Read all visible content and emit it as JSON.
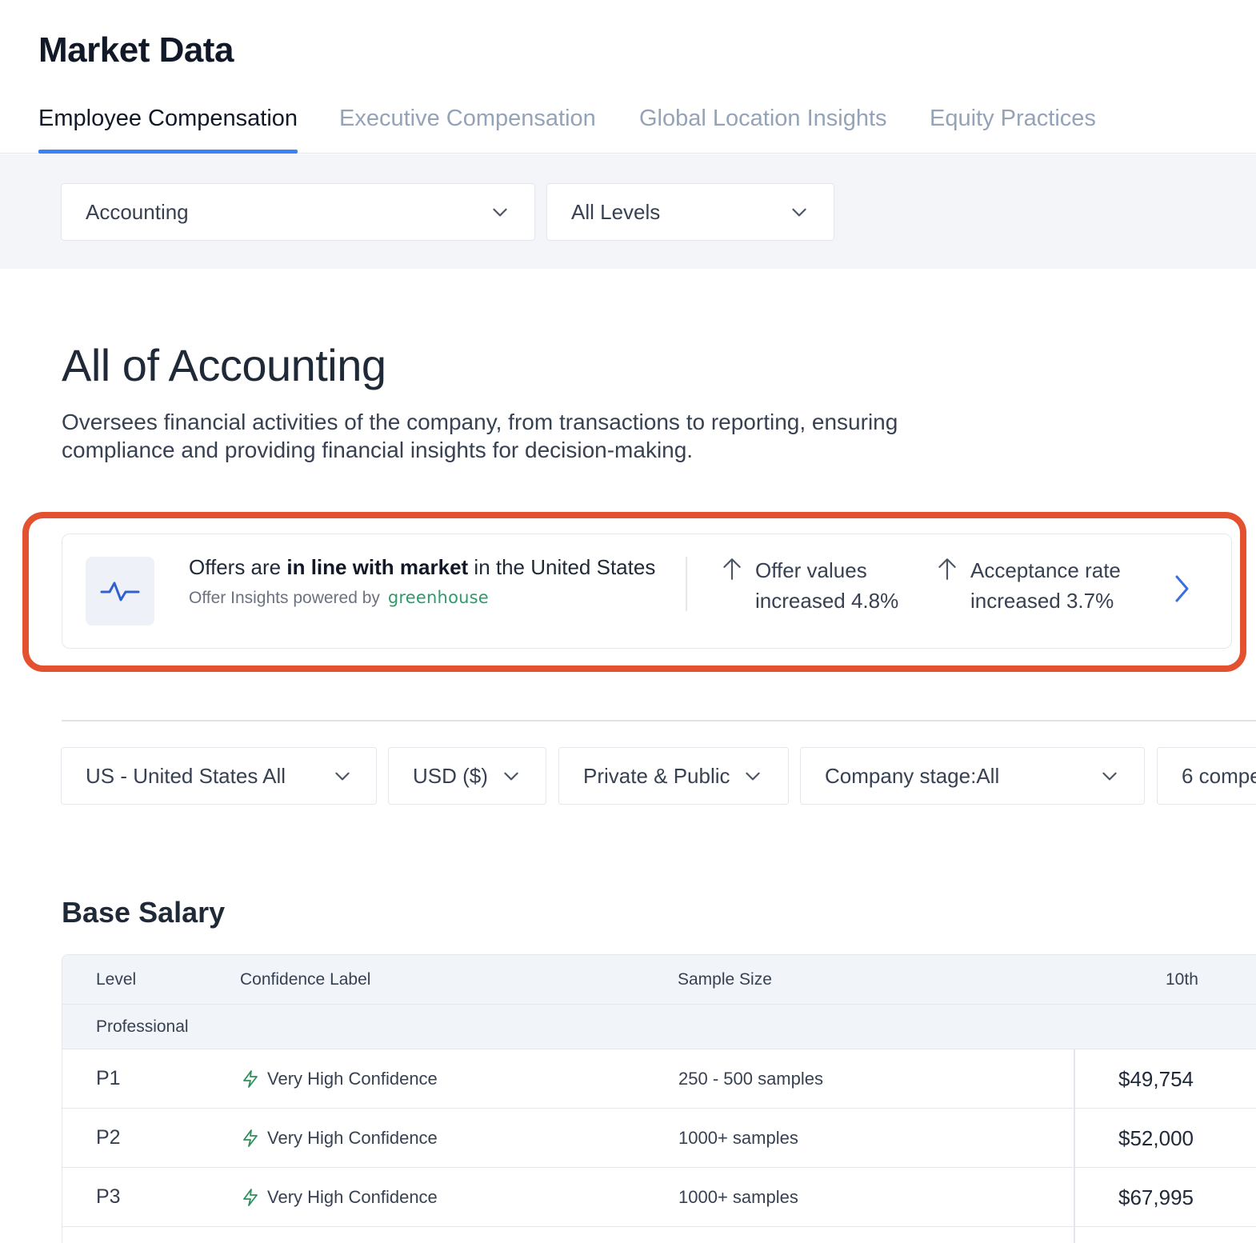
{
  "page": {
    "title": "Market Data"
  },
  "tabs": [
    {
      "label": "Employee Compensation",
      "active": true
    },
    {
      "label": "Executive Compensation",
      "active": false
    },
    {
      "label": "Global Location Insights",
      "active": false
    },
    {
      "label": "Equity Practices",
      "active": false
    }
  ],
  "filters": {
    "job_family": "Accounting",
    "level": "All Levels"
  },
  "section": {
    "title": "All of Accounting",
    "description": "Oversees financial activities of the company, from transactions to reporting, ensuring compliance and providing financial insights for decision-making."
  },
  "insight": {
    "prefix": "Offers are ",
    "emphasis": "in line with market",
    "suffix": " in the United States",
    "powered_by": "Offer Insights powered by",
    "partner_logo": "greenhouse",
    "stat1": {
      "line1": "Offer values",
      "line2": "increased 4.8%"
    },
    "stat2": {
      "line1": "Acceptance rate",
      "line2": "increased 3.7%"
    },
    "icon": "pulse-icon",
    "highlight_color": "#e4512f",
    "accent_color": "#3b82f6"
  },
  "secondary_filters": {
    "location": "US - United States All",
    "currency": "USD ($)",
    "ownership": "Private & Public",
    "company_stage": "Company stage:All",
    "comparison": "6 compe"
  },
  "base_salary": {
    "title": "Base Salary",
    "columns": {
      "level": "Level",
      "confidence": "Confidence Label",
      "sample_size": "Sample Size",
      "p10": "10th"
    },
    "group": "Professional",
    "rows": [
      {
        "level": "P1",
        "confidence": "Very High Confidence",
        "sample_size": "250 - 500 samples",
        "p10": "$49,754"
      },
      {
        "level": "P2",
        "confidence": "Very High Confidence",
        "sample_size": "1000+ samples",
        "p10": "$52,000"
      },
      {
        "level": "P3",
        "confidence": "Very High Confidence",
        "sample_size": "1000+ samples",
        "p10": "$67,995"
      }
    ]
  }
}
